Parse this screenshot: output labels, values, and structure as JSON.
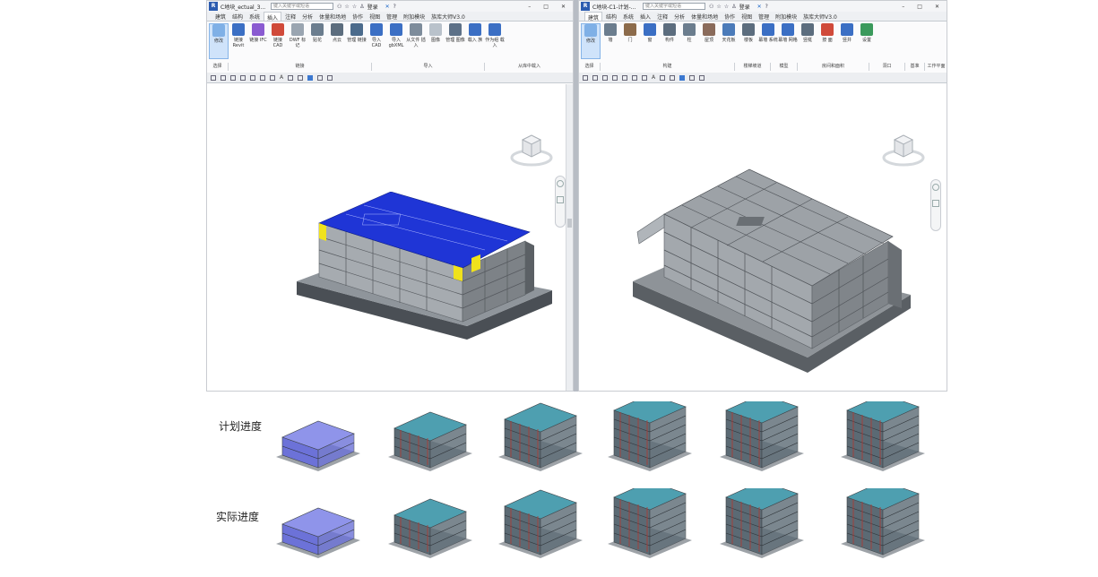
{
  "left_window": {
    "title": "C地块_ectual_3....",
    "search_placeholder": "键入关键字或短语",
    "login": "登录",
    "tabs": [
      {
        "label": "建筑",
        "active": false
      },
      {
        "label": "结构",
        "active": false
      },
      {
        "label": "系统",
        "active": false
      },
      {
        "label": "插入",
        "active": true
      },
      {
        "label": "注释",
        "active": false
      },
      {
        "label": "分析",
        "active": false
      },
      {
        "label": "体量和场地",
        "active": false
      },
      {
        "label": "协作",
        "active": false
      },
      {
        "label": "视图",
        "active": false
      },
      {
        "label": "管理",
        "active": false
      },
      {
        "label": "附加模块",
        "active": false
      },
      {
        "label": "族库大师V3.0",
        "active": false
      }
    ],
    "ribbon_buttons": [
      {
        "label": "修改",
        "icon": "cursor-icon",
        "color": "#7fb0e6"
      },
      {
        "label": "链接 Revit",
        "icon": "link-revit-icon",
        "color": "#3b6fc4"
      },
      {
        "label": "链接 IFC",
        "icon": "link-ifc-icon",
        "color": "#8a5bd1"
      },
      {
        "label": "链接 CAD",
        "icon": "link-cad-icon",
        "color": "#d04a3a"
      },
      {
        "label": "DWF 标记",
        "icon": "dwf-icon",
        "color": "#9aa5b1"
      },
      {
        "label": "贴花",
        "icon": "decal-icon",
        "color": "#6b7d8e"
      },
      {
        "label": "点云",
        "icon": "point-cloud-icon",
        "color": "#5c6d7e"
      },
      {
        "label": "管理 链接",
        "icon": "manage-links-icon",
        "color": "#4b6b8c"
      },
      {
        "label": "导入 CAD",
        "icon": "import-cad-icon",
        "color": "#3b6fc4"
      },
      {
        "label": "导入 gbXML",
        "icon": "import-gbxml-icon",
        "color": "#3b6fc4"
      },
      {
        "label": "从文件 插入",
        "icon": "insert-file-icon",
        "color": "#7d8c9b"
      },
      {
        "label": "图像",
        "icon": "image-icon",
        "color": "#b9c2cb"
      },
      {
        "label": "管理 图像",
        "icon": "manage-images-icon",
        "color": "#5d7188"
      },
      {
        "label": "载入 族",
        "icon": "load-family-icon",
        "color": "#3b6fc4"
      },
      {
        "label": "作为组 载入",
        "icon": "load-group-icon",
        "color": "#3b6fc4"
      }
    ],
    "panels": [
      "选择",
      "链接",
      "导入",
      "从库中载入"
    ]
  },
  "right_window": {
    "title": "C地块-C1-计划-...",
    "search_placeholder": "键入关键字或短语",
    "login": "登录",
    "tabs": [
      {
        "label": "建筑",
        "active": true
      },
      {
        "label": "结构",
        "active": false
      },
      {
        "label": "系统",
        "active": false
      },
      {
        "label": "插入",
        "active": false
      },
      {
        "label": "注释",
        "active": false
      },
      {
        "label": "分析",
        "active": false
      },
      {
        "label": "体量和场地",
        "active": false
      },
      {
        "label": "协作",
        "active": false
      },
      {
        "label": "视图",
        "active": false
      },
      {
        "label": "管理",
        "active": false
      },
      {
        "label": "附加模块",
        "active": false
      },
      {
        "label": "族库大师V3.0",
        "active": false
      }
    ],
    "ribbon_buttons": [
      {
        "label": "修改",
        "icon": "cursor-icon",
        "color": "#7fb0e6"
      },
      {
        "label": "墙",
        "icon": "wall-icon",
        "color": "#6b7d8e"
      },
      {
        "label": "门",
        "icon": "door-icon",
        "color": "#8c6b4b"
      },
      {
        "label": "窗",
        "icon": "window-icon",
        "color": "#3b6fc4"
      },
      {
        "label": "构件",
        "icon": "component-icon",
        "color": "#5c6d7e"
      },
      {
        "label": "柱",
        "icon": "column-icon",
        "color": "#6b7d8e"
      },
      {
        "label": "屋顶",
        "icon": "roof-icon",
        "color": "#8a6b5b"
      },
      {
        "label": "天花板",
        "icon": "ceiling-icon",
        "color": "#4b7bb9"
      },
      {
        "label": "楼板",
        "icon": "floor-icon",
        "color": "#5c6d7e"
      },
      {
        "label": "幕墙 系统",
        "icon": "curtain-system-icon",
        "color": "#3b6fc4"
      },
      {
        "label": "幕墙 网格",
        "icon": "curtain-grid-icon",
        "color": "#3b6fc4"
      },
      {
        "label": "竖梃",
        "icon": "mullion-icon",
        "color": "#5c6d7e"
      },
      {
        "label": "按 面",
        "icon": "by-face-icon",
        "color": "#d04a3a"
      },
      {
        "label": "竖井",
        "icon": "shaft-icon",
        "color": "#3b6fc4"
      },
      {
        "label": "设置",
        "icon": "set-icon",
        "color": "#3b9a5c"
      }
    ],
    "panels": [
      "选择",
      "构建",
      "楼梯坡道",
      "模型",
      "房间和面积",
      "洞口",
      "基准",
      "工作平面"
    ]
  },
  "progress": {
    "planned_label": "计划进度",
    "actual_label": "实际进度",
    "stage_count": 6,
    "planned_color": "#6c72d8",
    "actual_color": "#6c72d8",
    "structure_color": "#5b6a74",
    "slab_color": "#4e9fb0",
    "pipe_color": "#b5372f"
  }
}
